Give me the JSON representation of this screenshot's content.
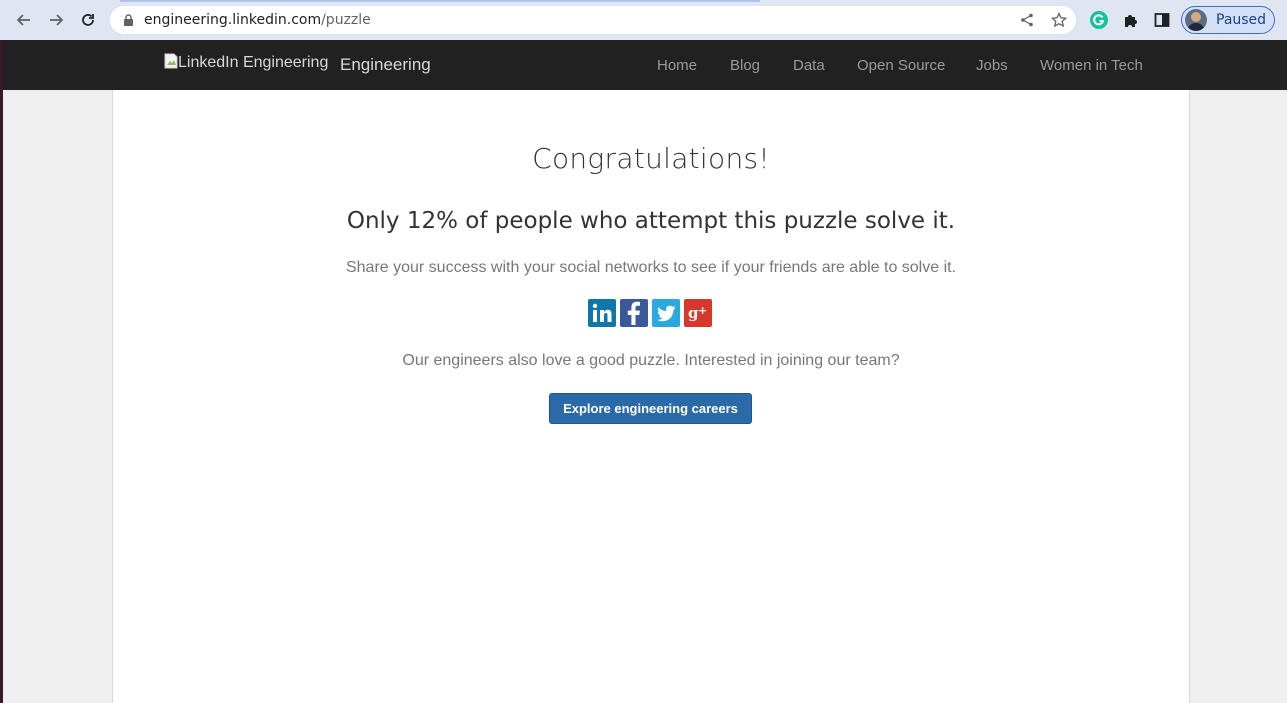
{
  "browser": {
    "url_host": "engineering.linkedin.com",
    "url_path": "/puzzle",
    "profile_status": "Paused"
  },
  "header": {
    "logo_alt": "LinkedIn Engineering",
    "brand": "Engineering",
    "nav": [
      "Home",
      "Blog",
      "Data",
      "Open Source",
      "Jobs",
      "Women in Tech"
    ]
  },
  "main": {
    "title": "Congratulations!",
    "subtitle": "Only 12% of people who attempt this puzzle solve it.",
    "share_text": "Share your success with your social networks to see if your friends are able to solve it.",
    "recruit_text": "Our engineers also love a good puzzle. Interested in joining our team?",
    "cta_label": "Explore engineering careers",
    "social": [
      {
        "name": "linkedin-icon",
        "glyph": "in",
        "color": "#0e76a8"
      },
      {
        "name": "facebook-icon",
        "glyph": "f",
        "color": "#3b5998"
      },
      {
        "name": "twitter-icon",
        "glyph": "🐦",
        "color": "#1da1f2"
      },
      {
        "name": "google-plus-icon",
        "glyph": "g+",
        "color": "#dd4b39"
      }
    ]
  },
  "colors": {
    "header_bg": "#212121",
    "button_bg": "#2a6aa8"
  }
}
